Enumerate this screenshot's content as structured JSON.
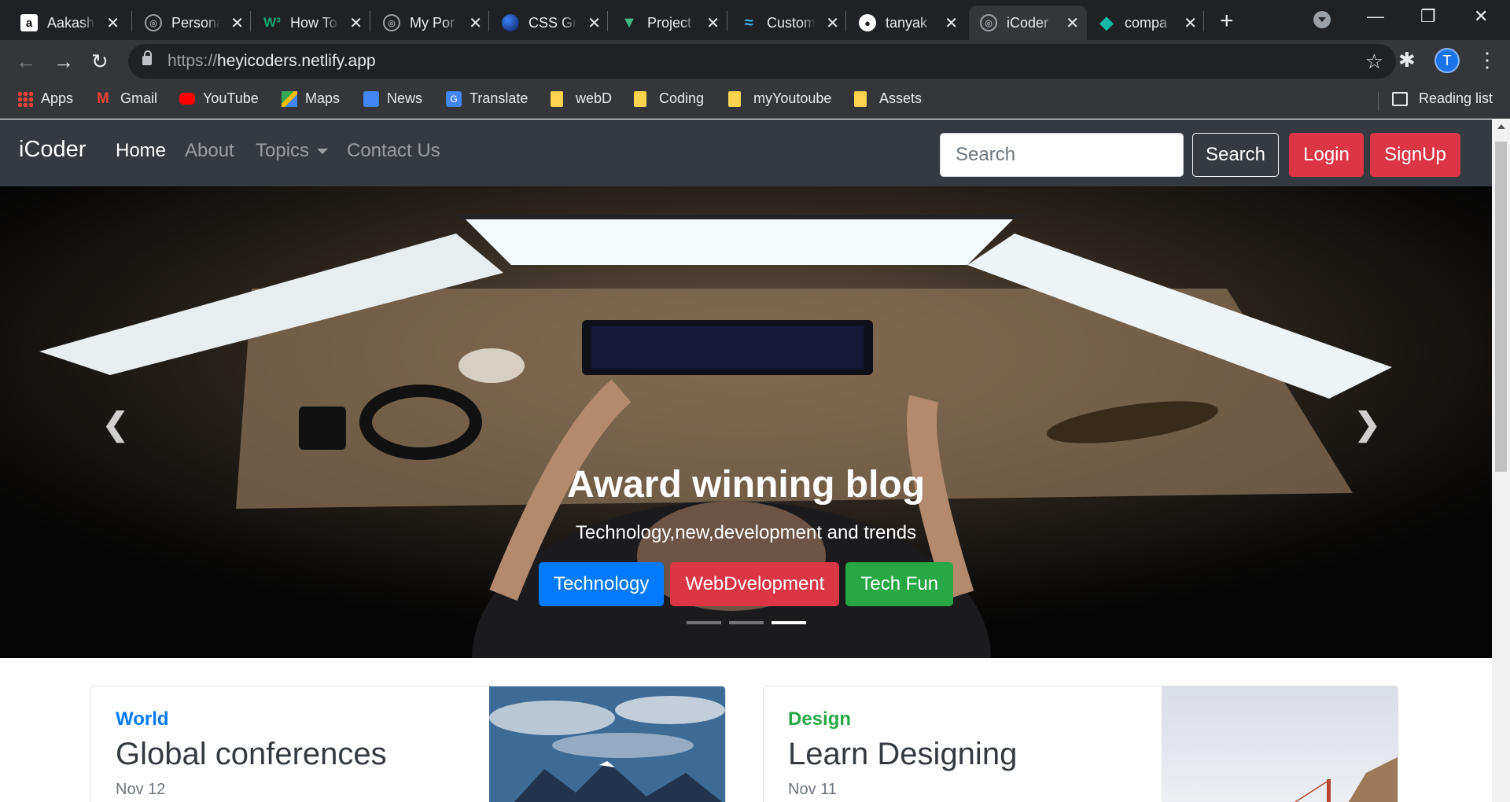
{
  "browser": {
    "tabs": [
      {
        "label": "Aakash",
        "favicon": "amazon-a-icon"
      },
      {
        "label": "Persona",
        "favicon": "globe-icon"
      },
      {
        "label": "How To",
        "favicon": "w3-icon"
      },
      {
        "label": "My Por",
        "favicon": "globe-icon"
      },
      {
        "label": "CSS Gr",
        "favicon": "css-grid-icon"
      },
      {
        "label": "Project",
        "favicon": "vue-icon"
      },
      {
        "label": "Custom",
        "favicon": "tailwind-icon"
      },
      {
        "label": "tanyak",
        "favicon": "github-icon"
      },
      {
        "label": "iCoder",
        "favicon": "globe-icon",
        "active": true
      },
      {
        "label": "compa",
        "favicon": "diamond-icon"
      }
    ],
    "url_scheme": "https://",
    "url_host": "heyicoders.netlify.app",
    "profile_initial": "T",
    "bookmarks": [
      "Apps",
      "Gmail",
      "YouTube",
      "Maps",
      "News",
      "Translate",
      "webD",
      "Coding",
      "myYoutoube",
      "Assets"
    ],
    "reading_list": "Reading list"
  },
  "site": {
    "brand": "iCoder",
    "nav": [
      {
        "label": "Home",
        "active": true
      },
      {
        "label": "About"
      },
      {
        "label": "Topics",
        "dropdown": true
      },
      {
        "label": "Contact Us"
      }
    ],
    "search_placeholder": "Search",
    "search_button": "Search",
    "login_button": "Login",
    "signup_button": "SignUp"
  },
  "hero": {
    "title": "Award winning blog",
    "subtitle": "Technology,new,development and trends",
    "buttons": [
      {
        "label": "Technology",
        "color": "#007bff"
      },
      {
        "label": "WebDvelopment",
        "color": "#dc3545"
      },
      {
        "label": "Tech Fun",
        "color": "#28a745"
      }
    ],
    "slides": 3,
    "active_slide": 3
  },
  "cards": [
    {
      "category": "World",
      "category_color": "#007bff",
      "title": "Global conferences",
      "date": "Nov 12"
    },
    {
      "category": "Design",
      "category_color": "#28a745",
      "title": "Learn Designing",
      "date": "Nov 11"
    }
  ]
}
